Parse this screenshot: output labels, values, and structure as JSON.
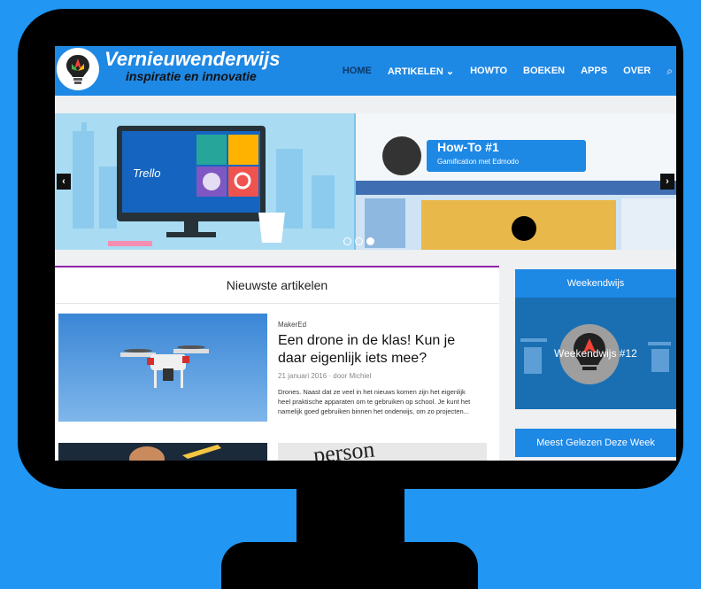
{
  "site": {
    "title": "Vernieuwenderwijs",
    "tagline": "inspiratie en innovatie"
  },
  "nav": {
    "items": [
      "HOME",
      "ARTIKELEN ⌄",
      "HOWTO",
      "BOEKEN",
      "APPS",
      "OVER"
    ],
    "search_icon": "⌕"
  },
  "hero": {
    "slide_1_text": "Trello",
    "slide_2_title": "How-To #1",
    "slide_2_subtitle": "Gamification met Edmodo",
    "prev_arrow": "‹",
    "next_arrow": "›"
  },
  "main": {
    "section_title": "Nieuwste artikelen",
    "article": {
      "category": "MakerEd",
      "title": "Een drone in de klas! Kun je daar eigenlijk iets mee?",
      "meta": "21 januari 2016 · door Michiel",
      "excerpt": "Drones. Naast dat ze veel in het nieuws komen zijn het eigenlijk heel praktische apparaten om te gebruiken op school. Je kunt het namelijk goed gebruiken binnen het onderwijs, om zo projecten..."
    },
    "article_3_text": "person"
  },
  "sidebar": {
    "widget_1_title": "Weekendwijs",
    "weekend_label": "Weekendwijs #12",
    "widget_2_title": "Meest Gelezen Deze Week"
  },
  "colors": {
    "background": "#2196f3",
    "header": "#1e88e5",
    "accent_border": "#8e24aa"
  }
}
